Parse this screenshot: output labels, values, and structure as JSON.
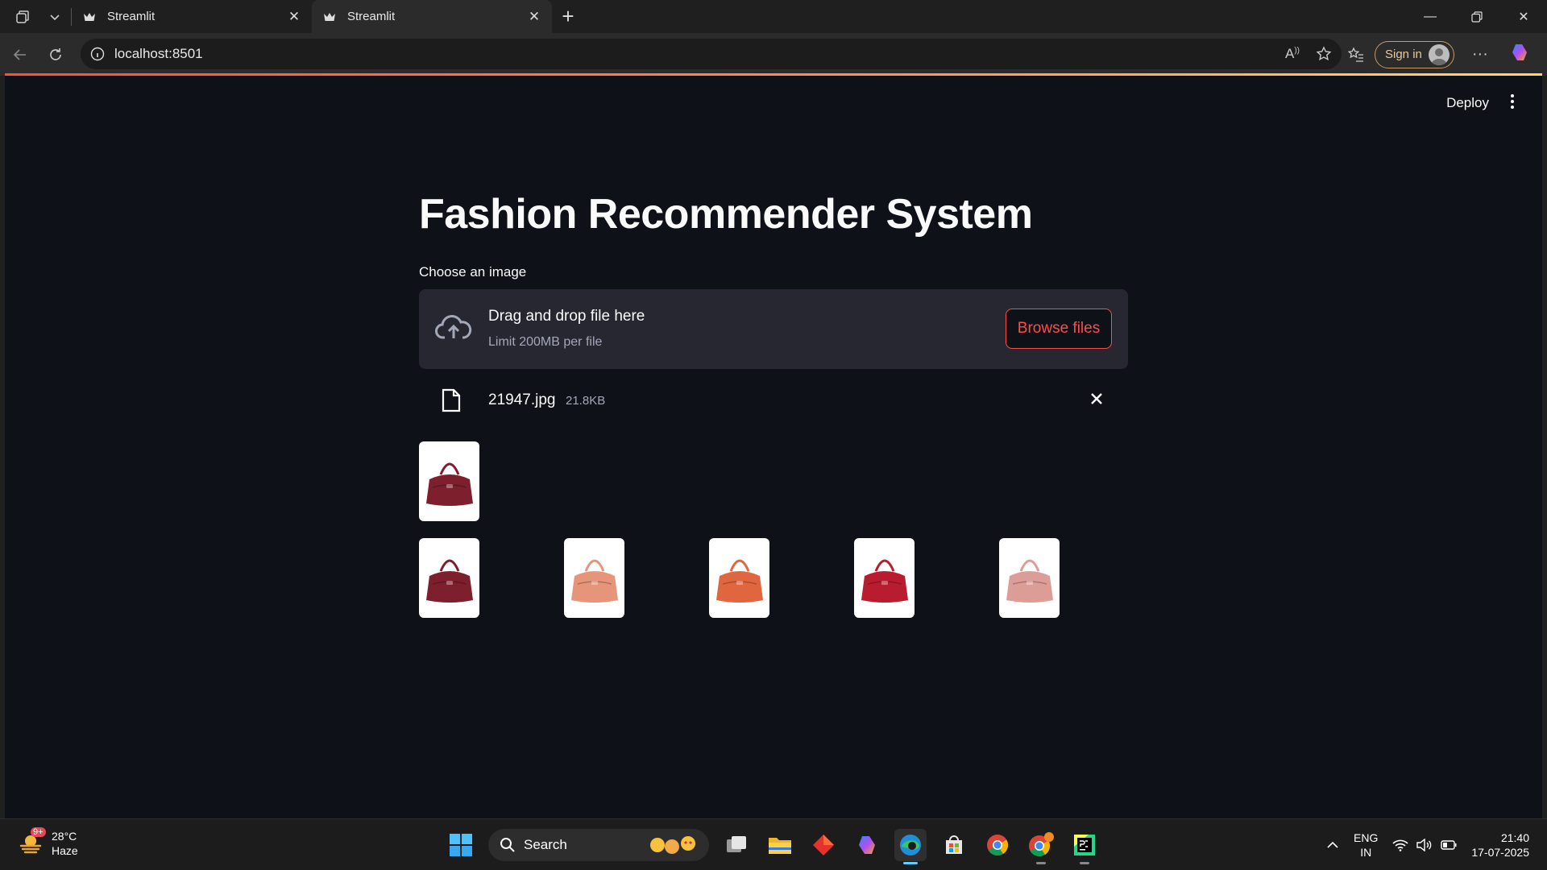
{
  "browser": {
    "tabs": [
      {
        "title": "Streamlit",
        "active": false
      },
      {
        "title": "Streamlit",
        "active": true
      }
    ],
    "url": "localhost:8501",
    "sign_in": "Sign in"
  },
  "app": {
    "deploy": "Deploy",
    "title": "Fashion Recommender System",
    "uploader": {
      "label": "Choose an image",
      "drop_text": "Drag and drop file here",
      "limit_text": "Limit 200MB per file",
      "browse_label": "Browse files"
    },
    "uploaded_file": {
      "name": "21947.jpg",
      "size": "21.8KB"
    },
    "input_image": {
      "color": "#7d1f2c"
    },
    "recommendations": [
      {
        "color": "#7d1f2c"
      },
      {
        "color": "#e7957a"
      },
      {
        "color": "#e0663f"
      },
      {
        "color": "#b81c2e"
      },
      {
        "color": "#dd9d97"
      }
    ],
    "accent_color": "#ff4b4b"
  },
  "taskbar": {
    "weather": {
      "temp": "28°C",
      "condition": "Haze",
      "badge": "9+"
    },
    "search": "Search",
    "language": {
      "line1": "ENG",
      "line2": "IN"
    },
    "clock": {
      "time": "21:40",
      "date": "17-07-2025"
    }
  }
}
